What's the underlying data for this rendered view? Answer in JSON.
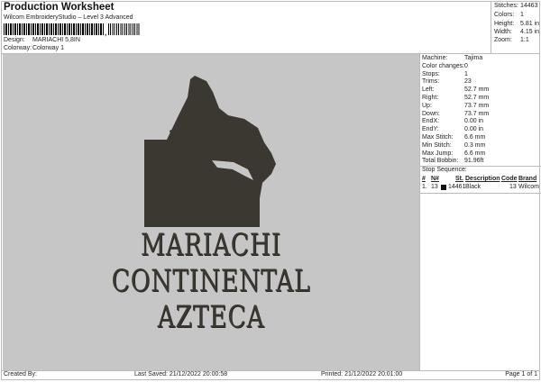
{
  "header": {
    "title": "Production Worksheet",
    "subtitle": "Wilcom EmbroideryStudio – Level 3 Advanced",
    "design_label": "Design:",
    "design": "MARIACHI 5,8IN",
    "colorway_label": "Colorway:",
    "colorway": "Colorway 1"
  },
  "stats": [
    {
      "k": "Stitches:",
      "v": "14463"
    },
    {
      "k": "Colors:",
      "v": "1"
    },
    {
      "k": "Height:",
      "v": "5.81 in"
    },
    {
      "k": "Width:",
      "v": "4.15 in"
    },
    {
      "k": "Zoom:",
      "v": "1:1"
    }
  ],
  "details": [
    {
      "k": "Machine:",
      "v": "Tajima"
    },
    {
      "k": "Color changes:",
      "v": "0"
    },
    {
      "k": "Stops:",
      "v": "1"
    },
    {
      "k": "Trims:",
      "v": "23"
    },
    {
      "k": "Left:",
      "v": "52.7 mm"
    },
    {
      "k": "Right:",
      "v": "52.7 mm"
    },
    {
      "k": "Up:",
      "v": "73.7 mm"
    },
    {
      "k": "Down:",
      "v": "73.7 mm"
    },
    {
      "k": "EndX:",
      "v": "0.00 in"
    },
    {
      "k": "EndY:",
      "v": "0.00 in"
    },
    {
      "k": "Max Stitch:",
      "v": "6.6 mm"
    },
    {
      "k": "Min Stitch:",
      "v": "0.3 mm"
    },
    {
      "k": "Max Jump:",
      "v": "6.6 mm"
    },
    {
      "k": "Total Bobbin:",
      "v": "91.96ft"
    }
  ],
  "stop_sequence": {
    "label": "Stop Sequence:",
    "headers": [
      "#",
      "N#",
      "St.",
      "Description",
      "Code",
      "Brand"
    ],
    "rows": [
      {
        "num": "1.",
        "needle": "13",
        "color": "#111111",
        "st": "14461",
        "desc": "Black",
        "code": "13",
        "brand": "Wilcom"
      }
    ]
  },
  "design_text": [
    "MARIACHI",
    "CONTINENTAL",
    "AZTECA"
  ],
  "footer": {
    "created": "Created By:",
    "saved": "Last Saved: 21/12/2022 20:00:58",
    "printed": "Printed: 21/12/2022 20:01:00",
    "page": "Page 1 of 1"
  }
}
